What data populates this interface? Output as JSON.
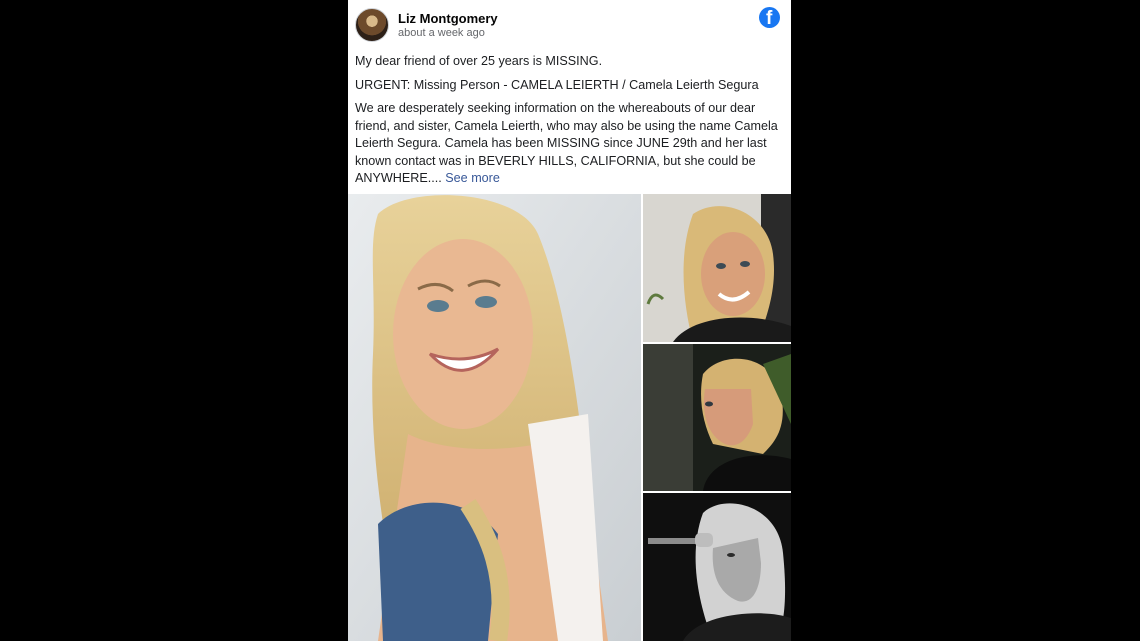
{
  "post": {
    "author": "Liz Montgomery",
    "timestamp": "about a week ago",
    "paragraphs": [
      "My dear friend of over 25 years is MISSING.",
      "URGENT: Missing Person - CAMELA LEIERTH / Camela Leierth Segura",
      "We are desperately seeking information on the whereabouts of our dear friend, and sister, Camela Leierth, who may also be using the name Camela Leierth Segura. Camela has been MISSING since JUNE 29th and her last known contact was in BEVERLY HILLS, CALIFORNIA, but she could be ANYWHERE...."
    ],
    "see_more": "See more",
    "brand_icon": "facebook-icon",
    "photos": [
      {
        "name": "main-photo",
        "subject": "smiling blonde woman, white background"
      },
      {
        "name": "photo-1",
        "subject": "blonde woman smiling indoors"
      },
      {
        "name": "photo-2",
        "subject": "blonde woman profile, dark background"
      },
      {
        "name": "photo-3",
        "subject": "black and white singer at microphone"
      }
    ]
  },
  "colors": {
    "background": "#000000",
    "card": "#ffffff",
    "link": "#385898",
    "brand": "#1877f2",
    "secondary_text": "#65676b"
  }
}
